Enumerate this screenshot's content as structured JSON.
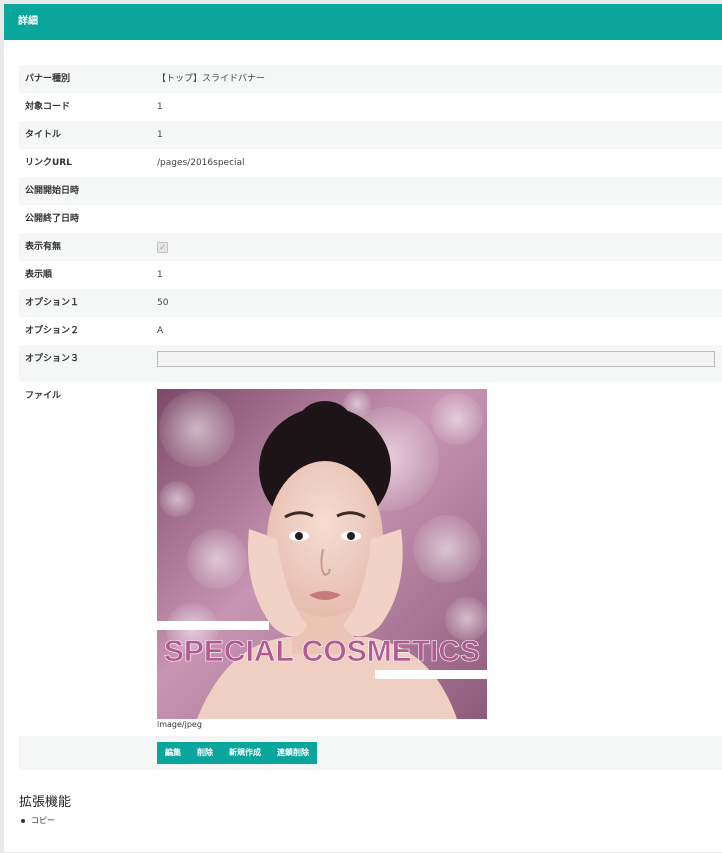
{
  "header": {
    "title": "詳細"
  },
  "detail": {
    "rows": [
      {
        "label": "バナー種別",
        "value": "【トップ】スライドバナー"
      },
      {
        "label": "対象コード",
        "value": "1"
      },
      {
        "label": "タイトル",
        "value": "1"
      },
      {
        "label": "リンクURL",
        "value": "/pages/2016special"
      },
      {
        "label": "公開開始日時",
        "value": ""
      },
      {
        "label": "公開終了日時",
        "value": ""
      },
      {
        "label": "表示有無",
        "checked": true
      },
      {
        "label": "表示順",
        "value": "1"
      },
      {
        "label": "オプション１",
        "value": "50"
      },
      {
        "label": "オプション２",
        "value": "A"
      },
      {
        "label": "オプション３",
        "value": ""
      }
    ],
    "file": {
      "label": "ファイル",
      "banner_text": "SPECIAL COSMETICS",
      "mime": "image/jpeg"
    }
  },
  "actions": {
    "edit": "編集",
    "delete": "削除",
    "create": "新規作成",
    "chain_delete": "連鎖削除"
  },
  "extensions": {
    "title": "拡張機能",
    "items": [
      "コピー"
    ]
  },
  "colors": {
    "accent": "#0aa69c",
    "banner_text": "#b35a93"
  }
}
